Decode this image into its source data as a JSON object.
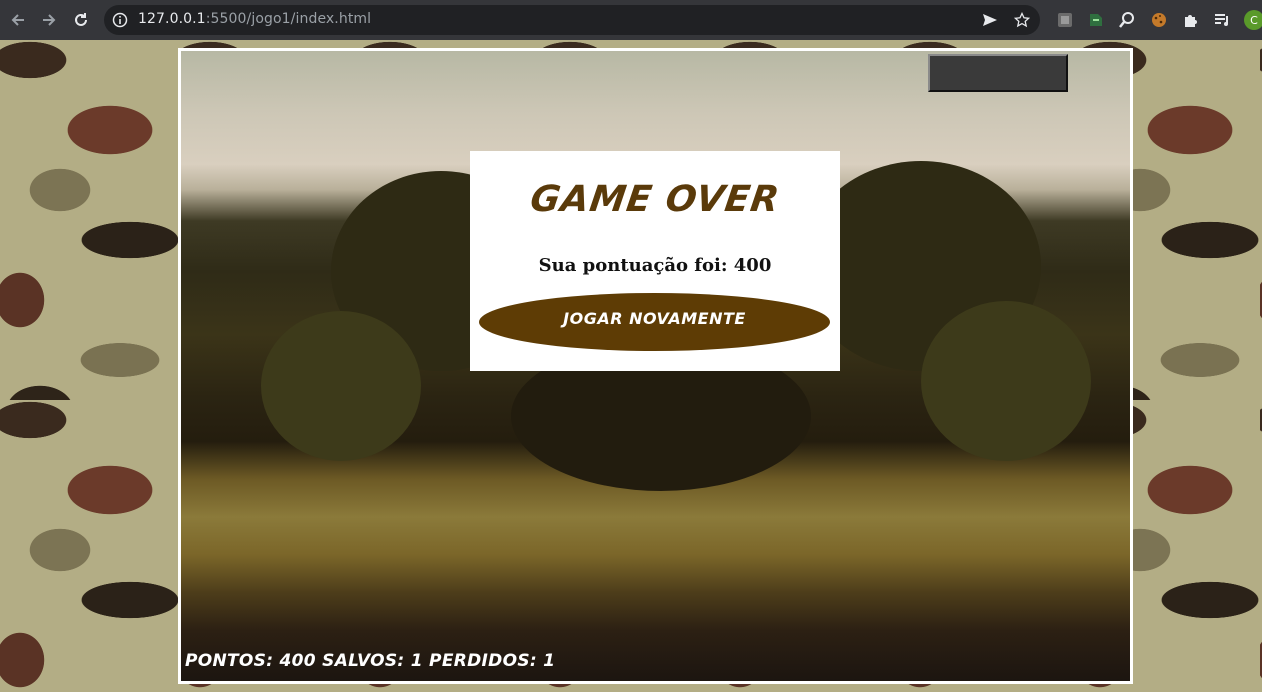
{
  "browser": {
    "url_host": "127.0.0.1",
    "url_rest": ":5500/jogo1/index.html",
    "avatar_letter": "C"
  },
  "game": {
    "title": "GAME OVER",
    "score_text": "Sua pontuação foi: 400",
    "replay_label": "JOGAR NOVAMENTE",
    "status_text": "PONTOS: 400 SALVOS: 1 PERDIDOS: 1",
    "colors": {
      "panel_bg": "#ffffff",
      "title": "#5a3a0a",
      "button_bg": "#5e3c05",
      "border": "#ffffff"
    }
  },
  "icons": {
    "toolbar": [
      "back-arrow-icon",
      "forward-arrow-icon",
      "reload-icon",
      "info-icon",
      "send-icon",
      "star-icon"
    ],
    "extensions": [
      "extension-1-icon",
      "extension-2-icon",
      "search-extension-icon",
      "cookie-icon",
      "puzzle-icon",
      "reading-list-icon"
    ]
  }
}
